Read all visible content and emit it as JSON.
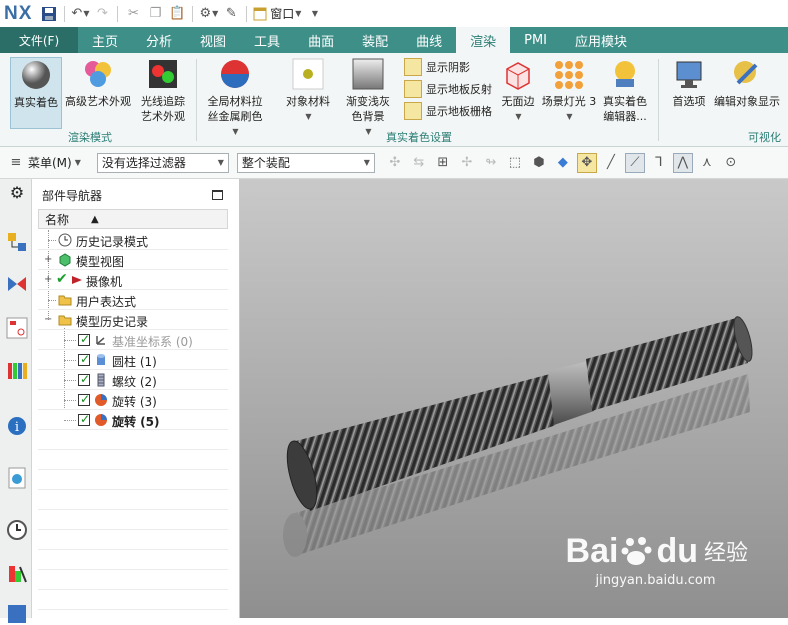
{
  "qat": {
    "logo": "NX",
    "window_menu": "窗口"
  },
  "ribbon_tabs": [
    "主页",
    "分析",
    "视图",
    "工具",
    "曲面",
    "装配",
    "曲线",
    "渲染",
    "PMI",
    "应用模块"
  ],
  "file_tab": "文件(F)",
  "active_tab": "渲染",
  "ribbon": {
    "true_shading": "真实着色",
    "advanced_art": "高级艺术外观",
    "raytrace_line1": "光线追踪",
    "raytrace_line2": "艺术外观",
    "group_render_mode": "渲染模式",
    "global_material_line1": "全局材料拉",
    "global_material_line2": "丝金属刷色",
    "object_material": "对象材料",
    "gradient_line1": "渐变浅灰",
    "gradient_line2": "色背景",
    "show_shadow": "显示阴影",
    "show_floor_reflection": "显示地板反射",
    "show_floor_grid": "显示地板栅格",
    "no_face_edge": "无面边",
    "scene_light": "场景灯光 3",
    "true_shading_editor_line1": "真实着色",
    "true_shading_editor_line2": "编辑器...",
    "group_true_shading_settings": "真实着色设置",
    "preferences": "首选项",
    "edit_object_display": "编辑对象显示",
    "group_visualization": "可视化"
  },
  "cmdbar": {
    "menu": "菜单(M)",
    "filter": "没有选择过滤器",
    "scope": "整个装配"
  },
  "navigator": {
    "title": "部件导航器",
    "column_name": "名称",
    "rows": [
      {
        "label": "历史记录模式"
      },
      {
        "label": "模型视图"
      },
      {
        "label": "摄像机"
      },
      {
        "label": "用户表达式"
      },
      {
        "label": "模型历史记录"
      },
      {
        "label": "基准坐标系 (0)"
      },
      {
        "label": "圆柱 (1)"
      },
      {
        "label": "螺纹 (2)"
      },
      {
        "label": "旋转 (3)"
      },
      {
        "label": "旋转 (5)"
      }
    ]
  },
  "watermark": {
    "brand": "Bai",
    "brand2": "du",
    "cn": "经验",
    "url": "jingyan.baidu.com"
  },
  "colors": {
    "tab_bar": "#3e8f88",
    "file_tab": "#2a6e67",
    "accent_text": "#2a7d74",
    "viewport_top": "#c9c9c9",
    "viewport_bottom": "#8f8f8f"
  }
}
